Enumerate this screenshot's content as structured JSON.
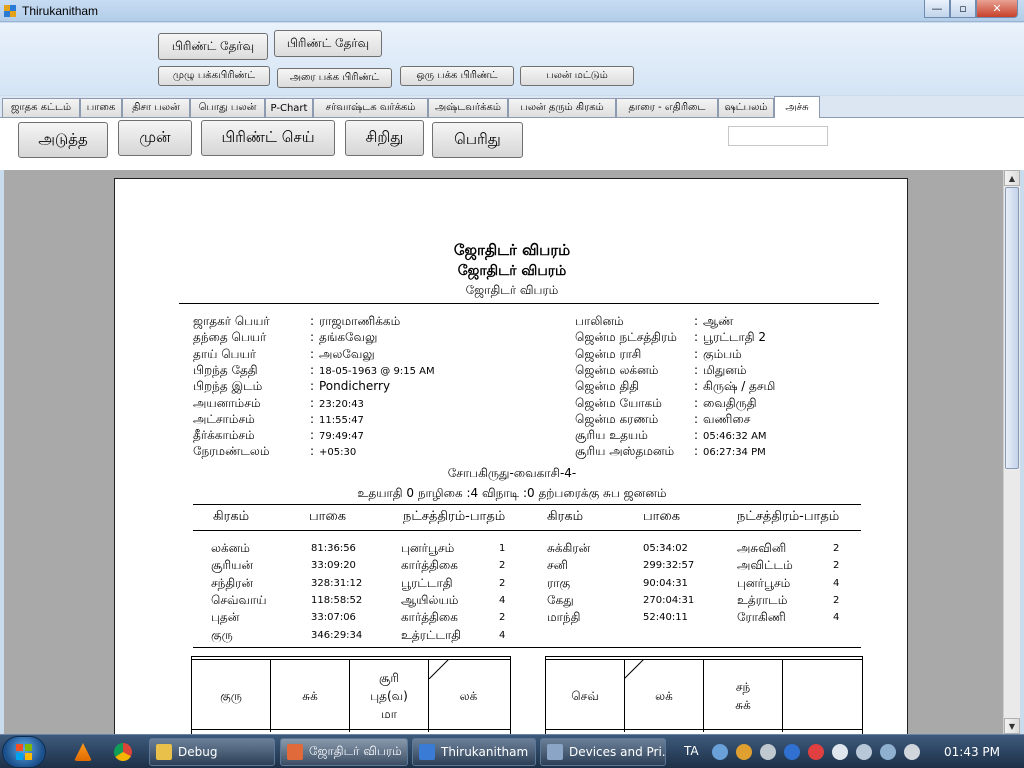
{
  "window": {
    "title": "Thirukanitham",
    "minimize_label": "—",
    "maximize_label": "▫",
    "close_label": "✕"
  },
  "toolbar": {
    "print_select_1": "பிரிண்ட் தேர்வு",
    "print_select_2": "பிரிண்ட் தேர்வு",
    "full_page_print": "முழு பக்கபிரிண்ட்",
    "half_page_print": "அரை பக்க பிரிண்ட்",
    "one_page_print": "ஒரு பக்க பிரிண்ட்",
    "result_only": "பலன் மட்டும்"
  },
  "tabs": [
    "ஜாதக கட்டம்",
    "பாகை",
    "திசா பலன்",
    "பொது பலன்",
    "P-Chart",
    "சர்வாஷ்டக வர்க்கம்",
    "அஷ்டவர்க்கம்",
    "பலன் தரும் கிரகம்",
    "தாரை - எதிரிடை",
    "ஷட்பலம்",
    "அச்சு"
  ],
  "print_panel": {
    "next": "அடுத்த",
    "prev": "முன்",
    "print": "பிரிண்ட் செய்",
    "smaller": "சிறிது",
    "larger": "பெரிது",
    "page_input": ""
  },
  "document": {
    "title_1": "ஜோதிடர் விபரம்",
    "title_2": "ஜோதிடர் விபரம்",
    "title_3": "ஜோதிடர் விபரம்",
    "left_details": [
      {
        "label": "ஜாதகர் பெயர்",
        "value": "ராஜமாணிக்கம்"
      },
      {
        "label": "தந்தை பெயர்",
        "value": "தங்கவேலு"
      },
      {
        "label": "தாய் பெயர்",
        "value": "அலவேலு"
      },
      {
        "label": "பிறந்த தேதி",
        "value": "18-05-1963 @ 9:15 AM"
      },
      {
        "label": "பிறந்த இடம்",
        "value": "Pondicherry"
      },
      {
        "label": "அயனாம்சம்",
        "value": "23:20:43"
      },
      {
        "label": "அட்சாம்சம்",
        "value": "11:55:47"
      },
      {
        "label": "தீர்க்காம்சம்",
        "value": "79:49:47"
      },
      {
        "label": "நேரமண்டலம்",
        "value": "+05:30"
      }
    ],
    "right_details": [
      {
        "label": "பாலினம்",
        "value": "ஆண்"
      },
      {
        "label": "ஜென்ம நட்சத்திரம்",
        "value": "பூரட்டாதி 2"
      },
      {
        "label": "ஜென்ம ராசி",
        "value": "கும்பம்"
      },
      {
        "label": "ஜென்ம லக்னம்",
        "value": "மிதுனம்"
      },
      {
        "label": "ஜென்ம திதி",
        "value": "கிருஷ் / தசமி"
      },
      {
        "label": "ஜென்ம யோகம்",
        "value": "வைதிருதி"
      },
      {
        "label": "ஜென்ம கரணம்",
        "value": "வணிசை"
      },
      {
        "label": "சூரிய உதயம்",
        "value": "05:46:32 AM"
      },
      {
        "label": "சூரிய அஸ்தமனம்",
        "value": "06:27:34 PM"
      }
    ],
    "year_line": "சோபகிருது-வைகாசி-4-",
    "udayathi_line": "உதயாதி  0  நாழிகை :4 விநாடி :0 தற்பரைக்கு சுப ஜனனம்",
    "grid_headers": [
      "கிரகம்",
      "பாகை",
      "நட்சத்திரம்-பாதம்",
      "கிரகம்",
      "பாகை",
      "நட்சத்திரம்-பாதம்"
    ],
    "planets_left": [
      {
        "name": "லக்னம்",
        "deg": "81:36:56",
        "star": "புனர்பூசம்",
        "pada": "1"
      },
      {
        "name": "சூரியன்",
        "deg": "33:09:20",
        "star": "கார்த்திகை",
        "pada": "2"
      },
      {
        "name": "சந்திரன்",
        "deg": "328:31:12",
        "star": "பூரட்டாதி",
        "pada": "2"
      },
      {
        "name": "செவ்வாய்",
        "deg": "118:58:52",
        "star": "ஆயில்யம்",
        "pada": "4"
      },
      {
        "name": "புதன்",
        "deg": "33:07:06",
        "star": "கார்த்திகை",
        "pada": "2"
      },
      {
        "name": "குரு",
        "deg": "346:29:34",
        "star": "உத்ரட்டாதி",
        "pada": "4"
      }
    ],
    "planets_right": [
      {
        "name": "சுக்கிரன்",
        "deg": "05:34:02",
        "star": "அசுவினி",
        "pada": "2"
      },
      {
        "name": "சனி",
        "deg": "299:32:57",
        "star": "அவிட்டம்",
        "pada": "2"
      },
      {
        "name": "ராகு",
        "deg": "90:04:31",
        "star": "புனர்பூசம்",
        "pada": "4"
      },
      {
        "name": "கேது",
        "deg": "270:04:31",
        "star": "உத்ராடம்",
        "pada": "2"
      },
      {
        "name": "மாந்தி",
        "deg": "52:40:11",
        "star": "ரோகிணி",
        "pada": "4"
      }
    ],
    "rasi_row": [
      [
        "குரு"
      ],
      [
        "சுக்"
      ],
      [
        "சூரி",
        "புத(வ)",
        "மா"
      ],
      [
        "லக்"
      ]
    ],
    "navamsa_row": [
      [
        "செவ்"
      ],
      [
        "லக்"
      ],
      [
        "சந்",
        "சுக்"
      ],
      [
        ""
      ]
    ]
  },
  "taskbar": {
    "items": [
      "Debug",
      "ஜோதிடர் விபரம்",
      "Thirukanitham",
      "Devices and Pri..."
    ],
    "lang": "TA",
    "clock": "01:43 PM"
  }
}
